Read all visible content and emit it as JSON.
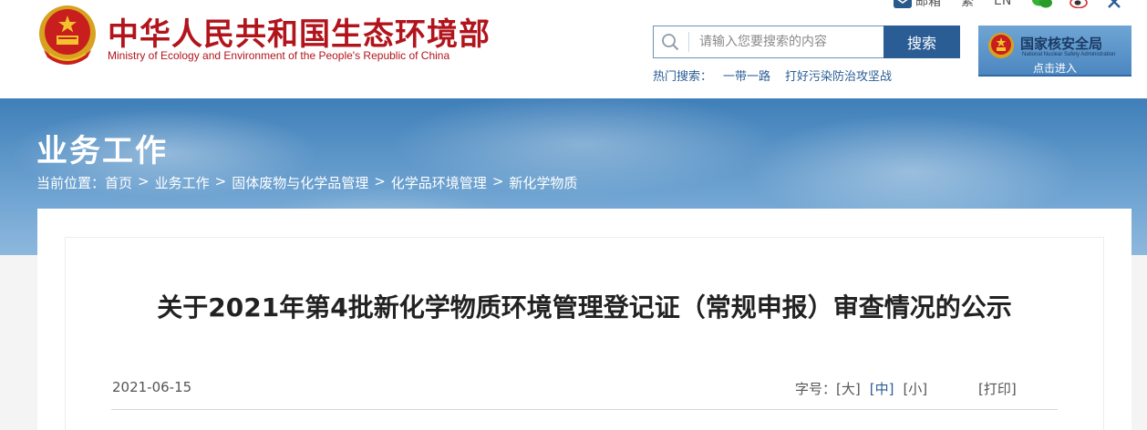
{
  "header": {
    "site_title": "中华人民共和国生态环境部",
    "site_subtitle": "Ministry of Ecology and Environment of the People's Republic of China",
    "top_links": {
      "mail": "邮箱",
      "traditional": "繁",
      "english": "EN"
    },
    "search": {
      "placeholder": "请输入您要搜索的内容",
      "button_label": "搜索"
    },
    "hot_search": {
      "label": "热门搜索：",
      "items": [
        "一带一路",
        "打好污染防治攻坚战"
      ]
    },
    "nnsa": {
      "title": "国家核安全局",
      "subtitle_en": "National Nuclear Safety Administration",
      "enter": "点击进入"
    }
  },
  "banner": {
    "section_title": "业务工作",
    "breadcrumb": {
      "prefix": "当前位置：",
      "items": [
        "首页",
        "业务工作",
        "固体废物与化学品管理",
        "化学品环境管理",
        "新化学物质"
      ],
      "separator": ">"
    }
  },
  "article": {
    "title": "关于2021年第4批新化学物质环境管理登记证（常规申报）审查情况的公示",
    "date": "2021-06-15",
    "font_size": {
      "label": "字号：",
      "large": "[大]",
      "medium": "[中]",
      "small": "[小]"
    },
    "print": "[打印]"
  },
  "colors": {
    "brand_red": "#b2141c",
    "brand_blue": "#2b5d95"
  }
}
